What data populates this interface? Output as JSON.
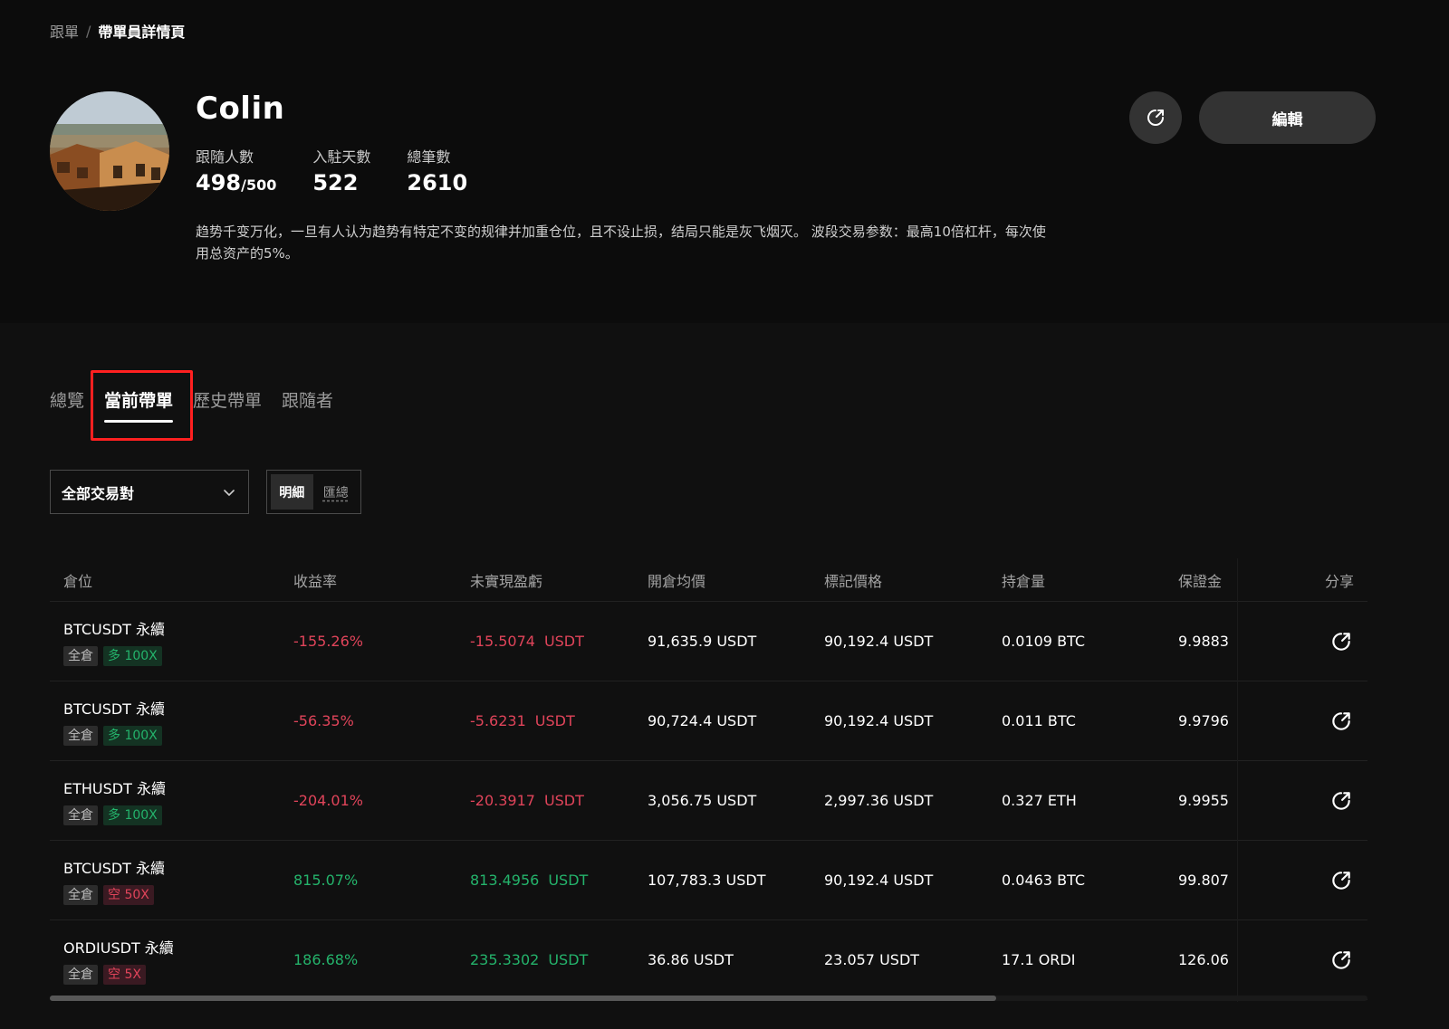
{
  "breadcrumb": {
    "root": "跟單",
    "separator": "/",
    "current": "帶單員詳情頁"
  },
  "profile": {
    "name": "Colin",
    "stats": [
      {
        "label": "跟隨人數",
        "value": "498",
        "suffix": "/500"
      },
      {
        "label": "入駐天數",
        "value": "522"
      },
      {
        "label": "總筆數",
        "value": "2610"
      }
    ],
    "bio": "趋势千变万化，一旦有人认为趋势有特定不变的规律并加重仓位，且不设止损，结局只能是灰飞烟灭。 波段交易参数：最高10倍杠杆，每次使用总资产的5%。"
  },
  "actions": {
    "share_icon": "share-icon",
    "edit_label": "編輯"
  },
  "tabs": [
    {
      "label": "總覽",
      "active": false
    },
    {
      "label": "當前帶單",
      "active": true
    },
    {
      "label": "歷史帶單",
      "active": false
    },
    {
      "label": "跟隨者",
      "active": false
    }
  ],
  "filters": {
    "pair_select": "全部交易對",
    "view_modes": [
      "明細",
      "匯總"
    ],
    "selected_view": "明細"
  },
  "table": {
    "headers": [
      "倉位",
      "收益率",
      "未實現盈虧",
      "開倉均價",
      "標記價格",
      "持倉量",
      "保證金",
      "分享"
    ],
    "rows": [
      {
        "symbol": "BTCUSDT 永續",
        "margin_mode": "全倉",
        "side": "多 100X",
        "side_type": "long",
        "roe": "-155.26%",
        "pnl": "-15.5074",
        "pnl_unit": "USDT",
        "trend": "neg",
        "entry": "91,635.9 USDT",
        "mark": "90,192.4 USDT",
        "size": "0.0109 BTC",
        "margin": "9.9883"
      },
      {
        "symbol": "BTCUSDT 永續",
        "margin_mode": "全倉",
        "side": "多 100X",
        "side_type": "long",
        "roe": "-56.35%",
        "pnl": "-5.6231",
        "pnl_unit": "USDT",
        "trend": "neg",
        "entry": "90,724.4 USDT",
        "mark": "90,192.4 USDT",
        "size": "0.011 BTC",
        "margin": "9.9796"
      },
      {
        "symbol": "ETHUSDT 永續",
        "margin_mode": "全倉",
        "side": "多 100X",
        "side_type": "long",
        "roe": "-204.01%",
        "pnl": "-20.3917",
        "pnl_unit": "USDT",
        "trend": "neg",
        "entry": "3,056.75 USDT",
        "mark": "2,997.36 USDT",
        "size": "0.327 ETH",
        "margin": "9.9955"
      },
      {
        "symbol": "BTCUSDT 永續",
        "margin_mode": "全倉",
        "side": "空 50X",
        "side_type": "short",
        "roe": "815.07%",
        "pnl": "813.4956",
        "pnl_unit": "USDT",
        "trend": "pos",
        "entry": "107,783.3 USDT",
        "mark": "90,192.4 USDT",
        "size": "0.0463 BTC",
        "margin": "99.807"
      },
      {
        "symbol": "ORDIUSDT 永續",
        "margin_mode": "全倉",
        "side": "空 5X",
        "side_type": "short",
        "roe": "186.68%",
        "pnl": "235.3302",
        "pnl_unit": "USDT",
        "trend": "pos",
        "entry": "36.86 USDT",
        "mark": "23.057 USDT",
        "size": "17.1 ORDI",
        "margin": "126.06"
      }
    ]
  },
  "colors": {
    "background": "#101010",
    "negative": "#e0445a",
    "positive": "#24b36b",
    "highlight": "#ff2020"
  }
}
